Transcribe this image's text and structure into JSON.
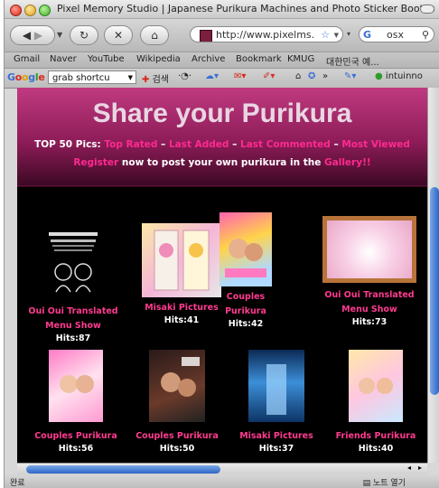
{
  "window": {
    "title": "Pixel Memory Studio | Japanese Purikura Machines and Photo Sticker Booths"
  },
  "toolbar": {
    "url": "http://www.pixelms.",
    "search_text": "osx"
  },
  "bookmarks": [
    "Gmail",
    "Naver",
    "YouTube",
    "Wikipedia",
    "Archive",
    "Bookmark",
    "KMUG",
    "대한민국 예..."
  ],
  "google_toolbar": {
    "search_value": "grab shortcu",
    "search_label": "검색",
    "more_label": "»",
    "account_label": "intuinno"
  },
  "page": {
    "title": "Share your Purikura",
    "top50_label": "TOP 50 Pics:",
    "links": [
      "Top Rated",
      "Last Added",
      "Last Commented",
      "Most Viewed"
    ],
    "separator": "–",
    "register_label": "Register",
    "register_middle": "now to post your own purikura in the",
    "gallery_label": "Gallery!!"
  },
  "items": [
    {
      "caption": "Oui Oui Translated Menu Show",
      "hits": "Hits:87"
    },
    {
      "caption": "Misaki Pictures",
      "hits": "Hits:41"
    },
    {
      "caption": "Couples Purikura",
      "hits": "Hits:42"
    },
    {
      "caption": "Oui Oui Translated Menu Show",
      "hits": "Hits:73"
    },
    {
      "caption": "Couples Purikura",
      "hits": "Hits:56"
    },
    {
      "caption": "Couples Purikura",
      "hits": "Hits:50"
    },
    {
      "caption": "Misaki Pictures",
      "hits": "Hits:37"
    },
    {
      "caption": "Friends Purikura",
      "hits": "Hits:40"
    }
  ],
  "status": {
    "left": "완료",
    "right": "노트 열기"
  },
  "colors": {
    "accent_pink": "#ff2a8f",
    "header_magenta": "#9b2063"
  }
}
